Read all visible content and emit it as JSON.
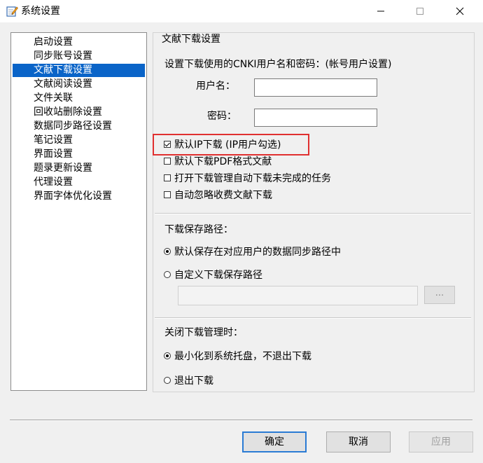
{
  "window": {
    "title": "系统设置",
    "icon": "notepad-pencil-icon"
  },
  "nav": {
    "items": [
      {
        "label": "启动设置"
      },
      {
        "label": "同步账号设置"
      },
      {
        "label": "文献下载设置",
        "selected": true
      },
      {
        "label": "文献阅读设置"
      },
      {
        "label": "文件关联"
      },
      {
        "label": "回收站删除设置"
      },
      {
        "label": "数据同步路径设置"
      },
      {
        "label": "笔记设置"
      },
      {
        "label": "界面设置"
      },
      {
        "label": "题录更新设置"
      },
      {
        "label": "代理设置"
      },
      {
        "label": "界面字体优化设置"
      }
    ]
  },
  "panel": {
    "title": "文献下载设置",
    "account_prompt": "设置下载使用的CNKI用户名和密码：(帐号用户设置)",
    "username_label": "用户名：",
    "username_value": "",
    "password_label": "密码：",
    "password_value": "",
    "options": [
      {
        "label": "默认IP下载 (IP用户勾选)",
        "checked": true
      },
      {
        "label": "默认下载PDF格式文献",
        "checked": false
      },
      {
        "label": "打开下载管理自动下载未完成的任务",
        "checked": false
      },
      {
        "label": "自动忽略收费文献下载",
        "checked": false
      }
    ],
    "save_path": {
      "label": "下载保存路径：",
      "options": [
        {
          "label": "默认保存在对应用户的数据同步路径中",
          "checked": true
        },
        {
          "label": "自定义下载保存路径",
          "checked": false
        }
      ],
      "path_value": "",
      "browse_label": "..."
    },
    "close_behavior": {
      "label": "关闭下载管理时：",
      "options": [
        {
          "label": "最小化到系统托盘，不退出下载",
          "checked": true
        },
        {
          "label": "退出下载",
          "checked": false
        }
      ]
    }
  },
  "footer": {
    "ok_label": "确定",
    "cancel_label": "取消",
    "apply_label": "应用"
  },
  "colors": {
    "selection": "#0a64c8",
    "highlight_box": "#e03030",
    "ok_border": "#2a7bd4"
  }
}
